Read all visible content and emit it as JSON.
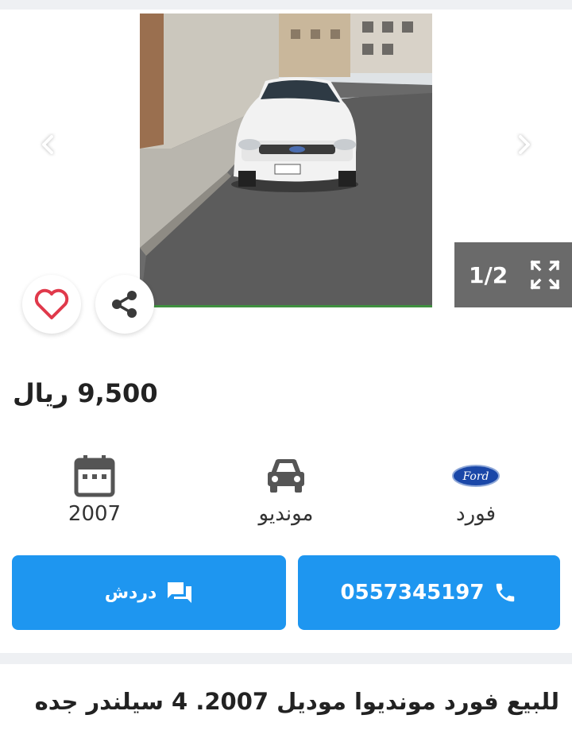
{
  "gallery": {
    "counter": "1/2"
  },
  "price": {
    "amount": "9,500",
    "currency": "ريال"
  },
  "specs": {
    "make": "فورد",
    "model": "مونديو",
    "year": "2007"
  },
  "actions": {
    "phone": "0557345197",
    "chat": "دردش"
  },
  "description": "للبيع فورد مونديوا موديل 2007. 4 سيلندر جده",
  "colors": {
    "accent": "#1e96f0",
    "heart": "#e0394b",
    "ford_blue": "#1a47a8"
  }
}
